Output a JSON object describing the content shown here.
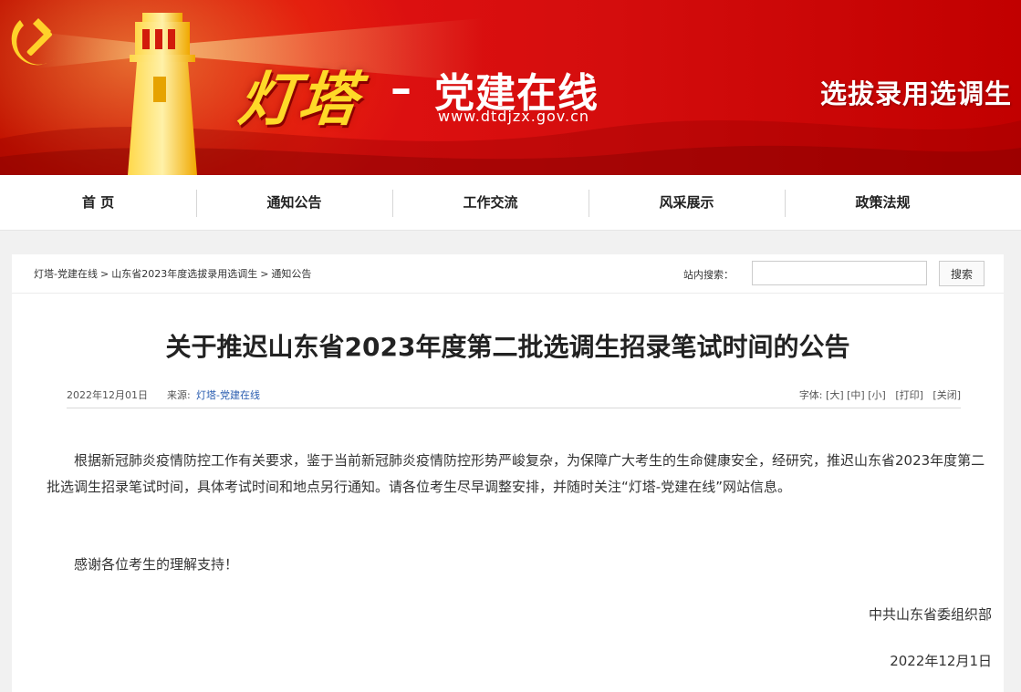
{
  "banner": {
    "brand": "灯塔",
    "dash": "–",
    "site_name": "党建在线",
    "site_url": "www.dtdjzx.gov.cn",
    "column_title": "选拔录用选调生",
    "colors": {
      "red": "#d40d0d",
      "gold": "#ffd928"
    },
    "icons": [
      "party-emblem-icon",
      "lighthouse-icon"
    ]
  },
  "nav": {
    "items": [
      {
        "label": "首 页"
      },
      {
        "label": "通知公告"
      },
      {
        "label": "工作交流"
      },
      {
        "label": "风采展示"
      },
      {
        "label": "政策法规"
      }
    ]
  },
  "breadcrumb": {
    "items": [
      "灯塔-党建在线",
      "山东省2023年度选拔录用选调生",
      "通知公告"
    ],
    "separator": ">"
  },
  "search": {
    "label": "站内搜索：",
    "value": "",
    "button_label": "搜索"
  },
  "article": {
    "title": "关于推迟山东省2023年度第二批选调生招录笔试时间的公告",
    "date": "2022年12月01日",
    "source_label": "来源:",
    "source_value": "灯塔-党建在线",
    "font_label": "字体:",
    "font_large": "[大]",
    "font_medium": "[中]",
    "font_small": "[小]",
    "print_label": "[打印]",
    "close_label": "[关闭]",
    "paragraphs": [
      "根据新冠肺炎疫情防控工作有关要求，鉴于当前新冠肺炎疫情防控形势严峻复杂，为保障广大考生的生命健康安全，经研究，推迟山东省2023年度第二批选调生招录笔试时间，具体考试时间和地点另行通知。请各位考生尽早调整安排，并随时关注“灯塔-党建在线”网站信息。",
      "感谢各位考生的理解支持！"
    ],
    "signature_org": "中共山东省委组织部",
    "signature_date": "2022年12月1日"
  }
}
